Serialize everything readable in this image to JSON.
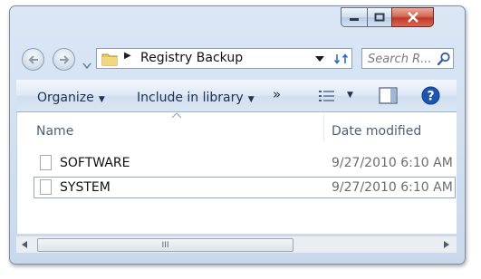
{
  "window": {
    "buttons": {
      "minimize": "minimize",
      "maximize": "maximize",
      "close": "close"
    }
  },
  "nav": {
    "back_glyph": "←",
    "forward_glyph": "→",
    "breadcrumb_arrow": "▶",
    "folder": "Registry Backup"
  },
  "search": {
    "placeholder": "Search R..."
  },
  "toolbar": {
    "organize": "Organize",
    "include_in_library": "Include in library",
    "more": "»"
  },
  "columns": {
    "name": "Name",
    "date_modified": "Date modified"
  },
  "files": [
    {
      "name": "SOFTWARE",
      "date": "9/27/2010 6:10 AM",
      "selected": false
    },
    {
      "name": "SYSTEM",
      "date": "9/27/2010 6:10 AM",
      "selected": true
    }
  ],
  "scroll": {
    "grip": "III"
  },
  "colors": {
    "accent": "#2f5fa7",
    "help": "#1c56b0",
    "close": "#c0392b"
  },
  "icons": [
    "back-icon",
    "forward-icon",
    "folder-icon",
    "refresh-icon",
    "search-icon",
    "views-icon",
    "preview-pane-icon",
    "help-icon",
    "file-icon"
  ]
}
